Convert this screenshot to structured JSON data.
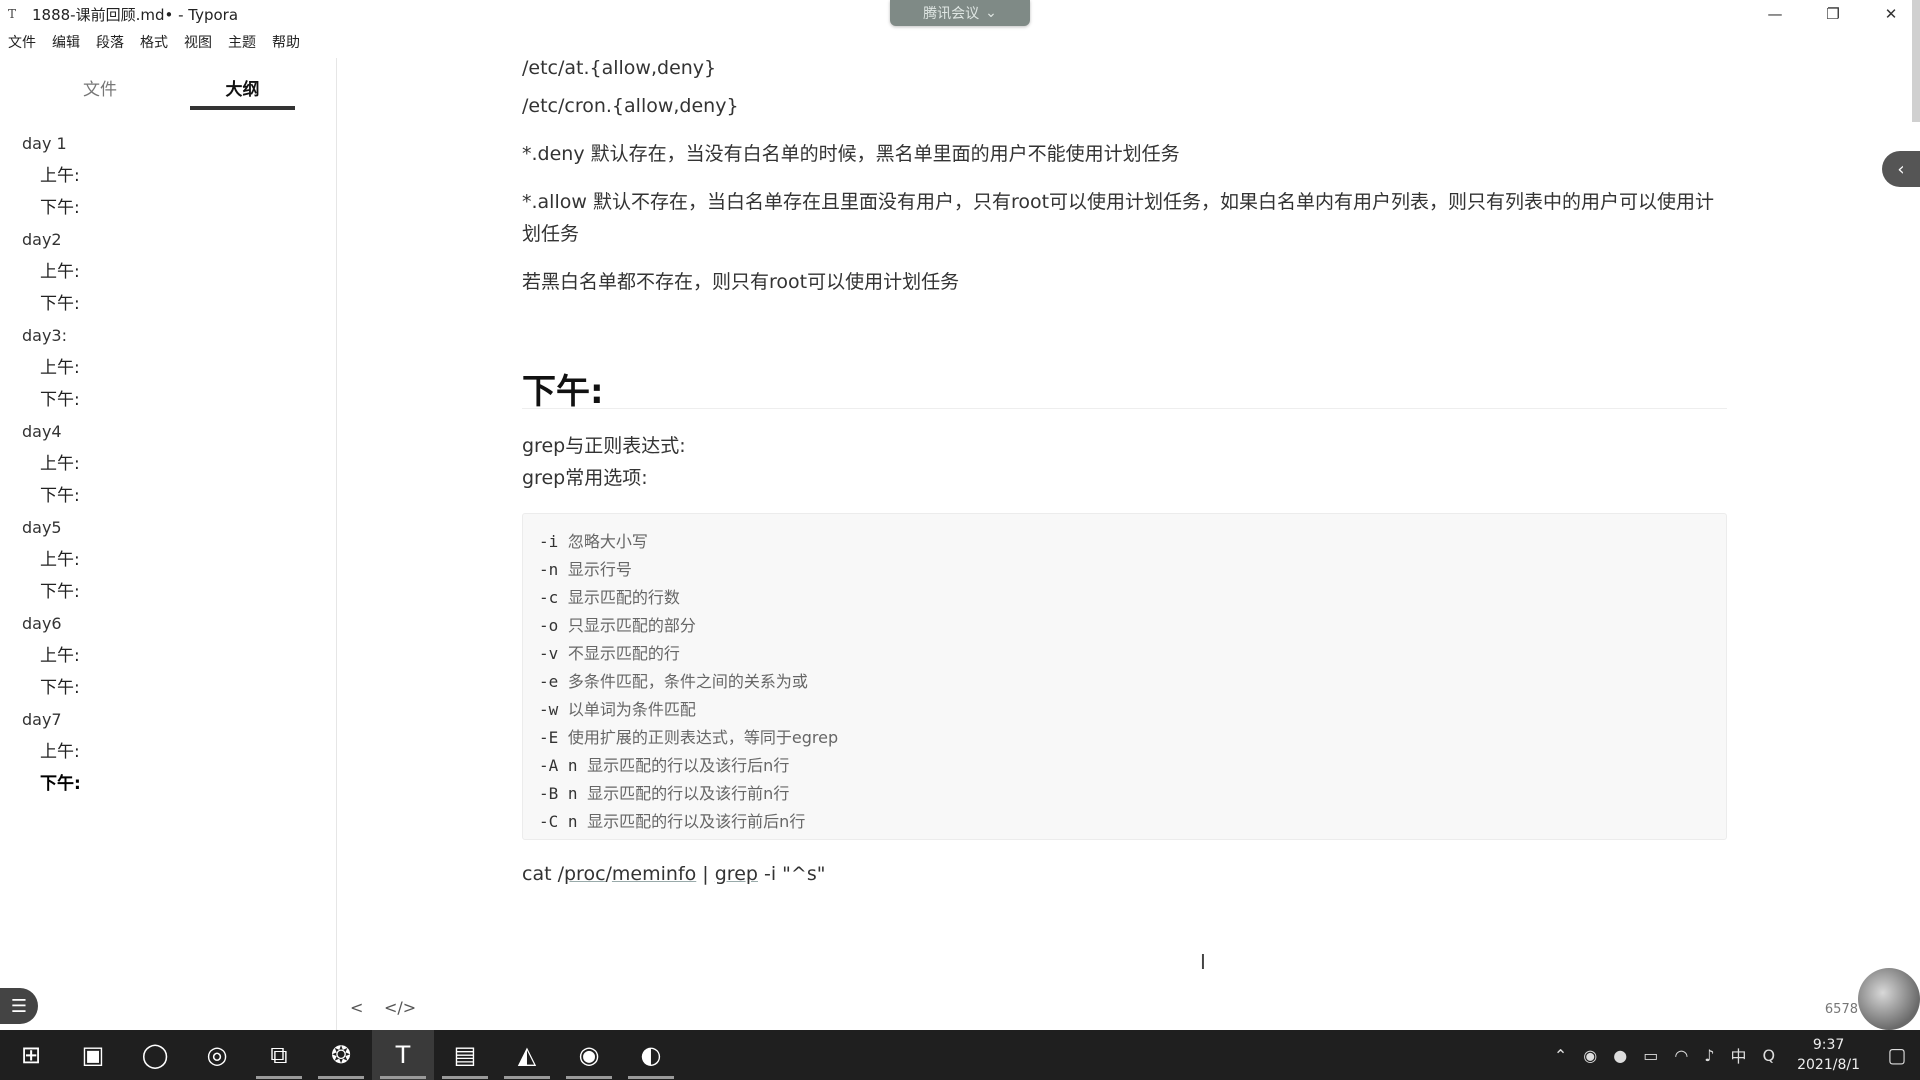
{
  "window": {
    "app_icon": "T",
    "title": "1888-课前回顾.md• - Typora",
    "meeting_label": "腾讯会议",
    "controls": [
      "—",
      "❐",
      "✕"
    ]
  },
  "menu": [
    "文件",
    "编辑",
    "段落",
    "格式",
    "视图",
    "主题",
    "帮助"
  ],
  "sidebar": {
    "tabs": [
      "文件",
      "大纲"
    ],
    "outline": [
      {
        "label": "day 1",
        "level": 2
      },
      {
        "label": "上午:",
        "level": 3
      },
      {
        "label": "下午:",
        "level": 3
      },
      {
        "label": "day2",
        "level": 2
      },
      {
        "label": "上午:",
        "level": 3
      },
      {
        "label": "下午:",
        "level": 3
      },
      {
        "label": "day3:",
        "level": 2
      },
      {
        "label": "上午:",
        "level": 3
      },
      {
        "label": "下午:",
        "level": 3
      },
      {
        "label": "day4",
        "level": 2
      },
      {
        "label": "上午:",
        "level": 3
      },
      {
        "label": "下午:",
        "level": 3
      },
      {
        "label": "day5",
        "level": 2
      },
      {
        "label": "上午:",
        "level": 3
      },
      {
        "label": "下午:",
        "level": 3
      },
      {
        "label": "day6",
        "level": 2
      },
      {
        "label": "上午:",
        "level": 3
      },
      {
        "label": "下午:",
        "level": 3
      },
      {
        "label": "day7",
        "level": 2
      },
      {
        "label": "上午:",
        "level": 3
      },
      {
        "label": "下午:",
        "level": 3
      }
    ],
    "active_index": 20
  },
  "doc": {
    "p1": "/etc/at.{allow,deny}",
    "p2": "/etc/cron.{allow,deny}",
    "p3": "*.deny 默认存在，当没有白名单的时候，黑名单里面的用户不能使用计划任务",
    "p4": "*.allow 默认不存在，当白名单存在且里面没有用户，只有root可以使用计划任务，如果白名单内有用户列表，则只有列表中的用户可以使用计划任务",
    "p5": "若黑白名单都不存在，则只有root可以使用计划任务",
    "heading": "下午:",
    "p6": "grep与正则表达式:",
    "p7": "grep常用选项:",
    "code": [
      {
        "opt": "-i",
        "desc": "忽略大小写"
      },
      {
        "opt": "-n",
        "desc": "显示行号"
      },
      {
        "opt": "-c",
        "desc": "显示匹配的行数"
      },
      {
        "opt": "-o",
        "desc": "只显示匹配的部分"
      },
      {
        "opt": "-v",
        "desc": "不显示匹配的行"
      },
      {
        "opt": "-e",
        "desc": "多条件匹配，条件之间的关系为或"
      },
      {
        "opt": "-w",
        "desc": "以单词为条件匹配"
      },
      {
        "opt": "-E",
        "desc": "使用扩展的正则表达式，等同于egrep"
      },
      {
        "opt": "-A n",
        "desc": "显示匹配的行以及该行后n行"
      },
      {
        "opt": "-B n",
        "desc": "显示匹配的行以及该行前n行"
      },
      {
        "opt": "-C n",
        "desc": "显示匹配的行以及该行前后n行"
      }
    ],
    "p8_parts": [
      "cat /",
      "proc",
      "/",
      "meminfo",
      " | ",
      "grep",
      " -i \"^s\""
    ]
  },
  "footer": {
    "back_icon": "<",
    "source_icon": "</>",
    "word_count": "6578"
  },
  "taskbar": {
    "icons": [
      "start-icon",
      "photo-app-icon",
      "cortana-icon",
      "wechat-icon",
      "task-view-icon",
      "tencent-meeting-icon",
      "typora-icon",
      "file-explorer-icon",
      "app-icon",
      "netease-music-icon",
      "edge-icon"
    ],
    "tray": {
      "ime": "中",
      "time": "9:37",
      "date": "2021/8/1"
    }
  }
}
